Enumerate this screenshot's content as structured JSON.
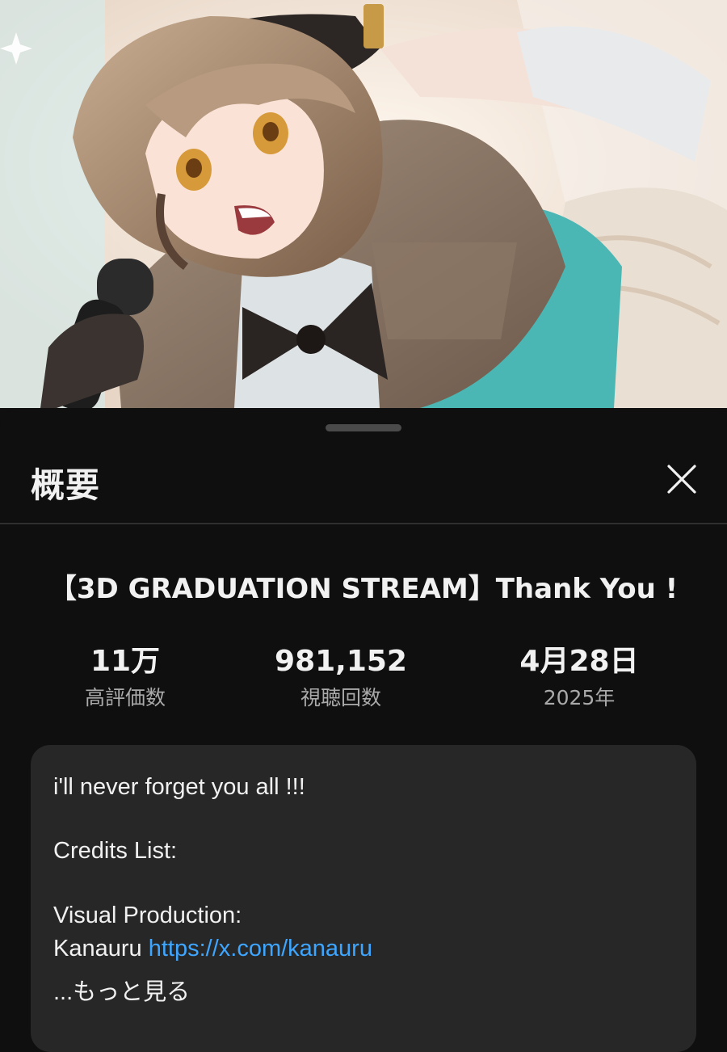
{
  "header": {
    "title": "概要",
    "close_icon": "close-icon"
  },
  "video": {
    "title": "【3D GRADUATION STREAM】Thank You !"
  },
  "stats": {
    "likes_value": "11万",
    "likes_label": "高評価数",
    "views_value": "981,152",
    "views_label": "視聴回数",
    "date_value": "4月28日",
    "date_label": "2025年"
  },
  "description": {
    "line1": "i'll never forget you all !!!",
    "line2": "Credits List:",
    "line3": "Visual Production:",
    "credit_name": "Kanauru",
    "credit_link": "https://x.com/kanauru",
    "more": "...もっと見る"
  },
  "colors": {
    "background": "#0f0f0f",
    "card": "#272727",
    "link": "#3ea6ff",
    "secondary_text": "#aaaaaa"
  }
}
